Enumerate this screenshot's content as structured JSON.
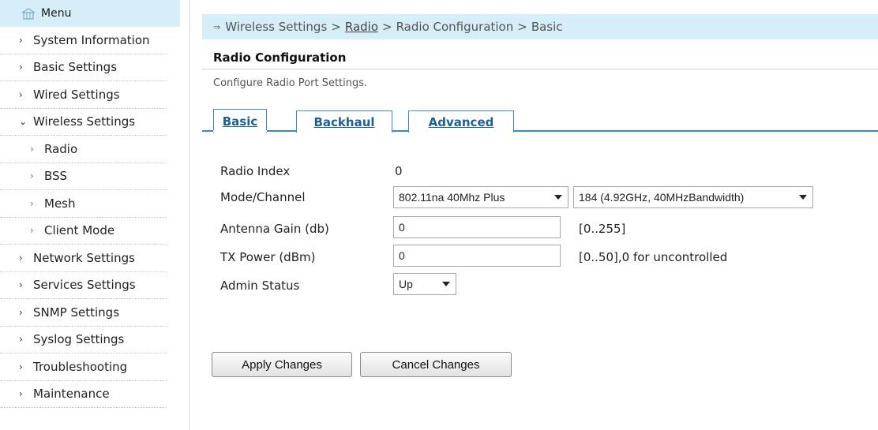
{
  "sidebar": {
    "header": "Menu",
    "items": [
      {
        "label": "System Information"
      },
      {
        "label": "Basic Settings"
      },
      {
        "label": "Wired Settings"
      },
      {
        "label": "Wireless Settings"
      },
      {
        "label": "Radio"
      },
      {
        "label": "BSS"
      },
      {
        "label": "Mesh"
      },
      {
        "label": "Client Mode"
      },
      {
        "label": "Network Settings"
      },
      {
        "label": "Services Settings"
      },
      {
        "label": "SNMP Settings"
      },
      {
        "label": "Syslog Settings"
      },
      {
        "label": "Troubleshooting"
      },
      {
        "label": "Maintenance"
      }
    ]
  },
  "breadcrumb": {
    "part1": "Wireless Settings",
    "part2": "Radio",
    "part3": "Radio Configuration",
    "part4": "Basic"
  },
  "page": {
    "title": "Radio Configuration",
    "description": "Configure Radio Port Settings."
  },
  "tabs": {
    "basic": "Basic",
    "backhaul": "Backhaul",
    "advanced": "Advanced"
  },
  "form": {
    "radio_index_label": "Radio Index",
    "radio_index_value": "0",
    "mode_channel_label": "Mode/Channel",
    "mode_value": "802.11na 40Mhz Plus",
    "channel_value": "184 (4.92GHz, 40MHzBandwidth)",
    "antenna_gain_label": "Antenna Gain (db)",
    "antenna_gain_value": "0",
    "antenna_gain_hint": "[0..255]",
    "tx_power_label": "TX Power (dBm)",
    "tx_power_value": "0",
    "tx_power_hint": "[0..50],0 for uncontrolled",
    "admin_status_label": "Admin Status",
    "admin_status_value": "Up"
  },
  "buttons": {
    "apply": "Apply Changes",
    "cancel": "Cancel Changes"
  },
  "colors": {
    "header_bg": "#d6eef9",
    "tab_border": "#3a89c9",
    "tab_text": "#1f5f97"
  }
}
